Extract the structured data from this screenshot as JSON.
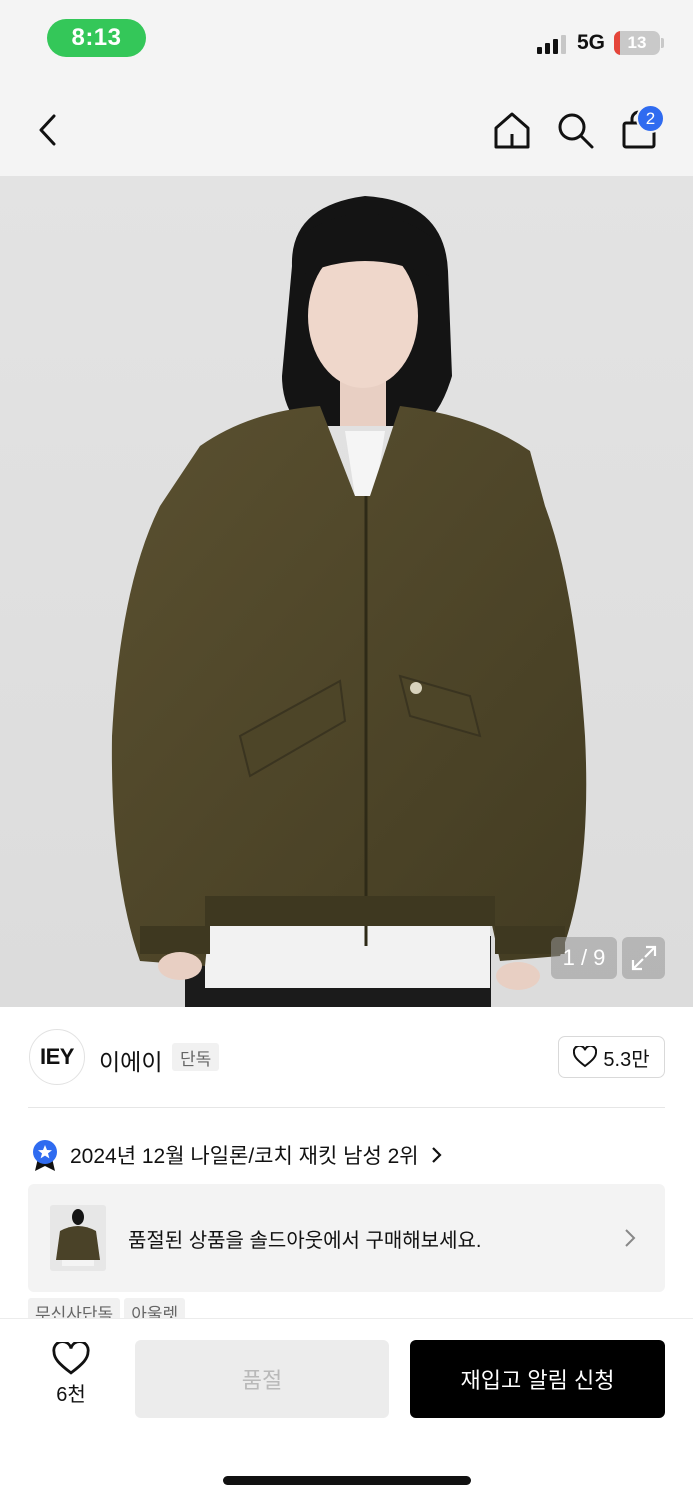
{
  "status_bar": {
    "time": "8:13",
    "network": "5G",
    "battery": "13",
    "battery_percent": 13,
    "time_pill_color": "#34c759",
    "battery_low_color": "#e5453a"
  },
  "header": {
    "icons": [
      "back-icon",
      "home-icon",
      "search-icon",
      "bag-icon"
    ],
    "cart_badge": "2",
    "badge_color": "#2f6bf0"
  },
  "gallery": {
    "counter": "1 / 9",
    "expand_icon": "expand-icon"
  },
  "brand": {
    "logo_text": "IEY",
    "name": "이에이",
    "badge": "단독",
    "likes": "5.3만"
  },
  "ranking": {
    "text": "2024년 12월 나일론/코치 재킷 남성 2위",
    "icon": "ranking-medal-icon",
    "accent": "#2f6bf0"
  },
  "soldout_promo": {
    "text": "품절된 상품을 솔드아웃에서 구매해보세요."
  },
  "tags": [
    "무신사단독",
    "아울렛"
  ],
  "bottom_bar": {
    "wish_count": "6천",
    "soldout_label": "품절",
    "restock_label": "재입고 알림 신청"
  }
}
